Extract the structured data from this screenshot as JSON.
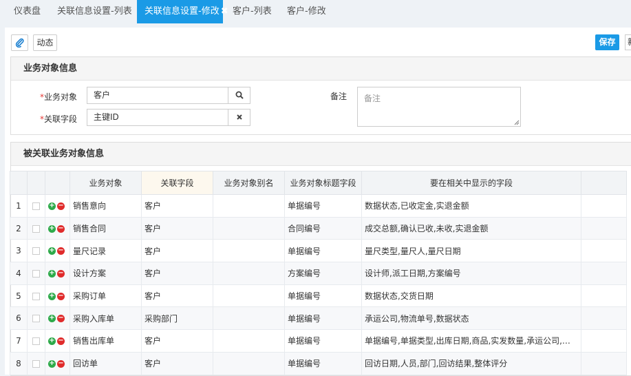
{
  "tabs": [
    {
      "label": "仪表盘"
    },
    {
      "label": "关联信息设置-列表"
    },
    {
      "label": "关联信息设置-修改"
    },
    {
      "label": "客户-列表"
    },
    {
      "label": "客户-修改"
    }
  ],
  "toolbar": {
    "dynamic_label": "动态",
    "save_label": "保存",
    "cut_label": "新"
  },
  "business_panel": {
    "title": "业务对象信息",
    "object_label": "*业务对象",
    "object_value": "客户",
    "field_label": "*关联字段",
    "field_value": "主键ID",
    "remark_label": "备注",
    "remark_placeholder": "备注"
  },
  "related_panel": {
    "title": "被关联业务对象信息",
    "columns": [
      "",
      "",
      "",
      "业务对象",
      "关联字段",
      "业务对象别名",
      "业务对象标题字段",
      "要在相关中显示的字段",
      ""
    ],
    "rows": [
      {
        "no": "1",
        "object": "销售意向",
        "field": "客户",
        "alias": "",
        "title_field": "单据编号",
        "display": "数据状态,已收定金,实退金额"
      },
      {
        "no": "2",
        "object": "销售合同",
        "field": "客户",
        "alias": "",
        "title_field": "合同编号",
        "display": "成交总额,确认已收,未收,实退金额"
      },
      {
        "no": "3",
        "object": "量尺记录",
        "field": "客户",
        "alias": "",
        "title_field": "单据编号",
        "display": "量尺类型,量尺人,量尺日期"
      },
      {
        "no": "4",
        "object": "设计方案",
        "field": "客户",
        "alias": "",
        "title_field": "方案编号",
        "display": "设计师,派工日期,方案编号"
      },
      {
        "no": "5",
        "object": "采购订单",
        "field": "客户",
        "alias": "",
        "title_field": "单据编号",
        "display": "数据状态,交货日期"
      },
      {
        "no": "6",
        "object": "采购入库单",
        "field": "采购部门",
        "alias": "",
        "title_field": "单据编号",
        "display": "承运公司,物流单号,数据状态"
      },
      {
        "no": "7",
        "object": "销售出库单",
        "field": "客户",
        "alias": "",
        "title_field": "单据编号",
        "display": "单据编号,单据类型,出库日期,商品,实发数量,承运公司,运…"
      },
      {
        "no": "8",
        "object": "回访单",
        "field": "客户",
        "alias": "",
        "title_field": "单据编号",
        "display": "回访日期,人员,部门,回访结果,整体评分"
      }
    ]
  },
  "colors": {
    "accent": "#1a9ae6",
    "add": "#2eaa4a",
    "delete": "#e02b2b",
    "required": "#e53935"
  }
}
